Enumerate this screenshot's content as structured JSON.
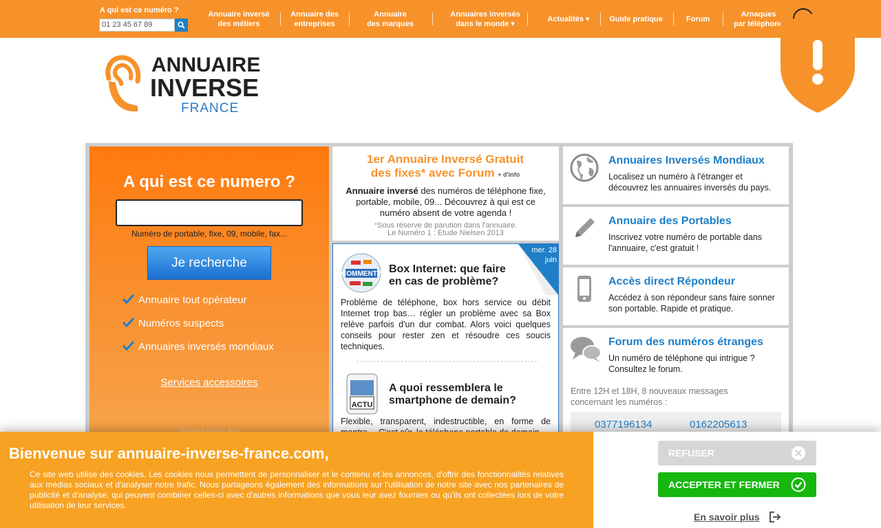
{
  "topbar": {
    "search_label": "A qui est ce numéro ?",
    "search_value": "01 23 45 67 89",
    "nav": [
      {
        "l1": "Annuaire inversé",
        "l2": "des métiers"
      },
      {
        "l1": "Annuaire des",
        "l2": "entreprises"
      },
      {
        "l1": "Annuaire",
        "l2": "des marques"
      },
      {
        "l1": "Annuaires inversés",
        "l2": "dans le monde ▾"
      },
      {
        "l1": "Actualités ▾",
        "l2": ""
      },
      {
        "l1": "Guide pratique",
        "l2": ""
      },
      {
        "l1": "Forum",
        "l2": ""
      },
      {
        "l1": "Arnaques",
        "l2": "par téléphone"
      }
    ]
  },
  "logo": {
    "line1": "ANNUAIRE",
    "line2": "INVERSE",
    "line3": "FRANCE"
  },
  "search_panel": {
    "title": "A qui est ce numero ?",
    "hint": "Numéro de portable, fixe, 09, mobile, fax...",
    "button": "Je recherche",
    "features": [
      "Annuaire tout opérateur",
      "Numéros suspects",
      "Annuaires inversés mondiaux"
    ],
    "services_link": "Services accessoires",
    "follow": "Suivez-nous sur"
  },
  "promo": {
    "title_l1": "1er Annuaire Inversé Gratuit",
    "title_l2": "des fixes* avec Forum",
    "info": "+ d'info",
    "body_bold": "Annuaire inversé",
    "body_rest": " des numéros de téléphone fixe, portable, mobile, 09... Découvrez à qui est ce numéro absent de votre agenda !",
    "note_star": "*",
    "note_l1": "Sous réserve de parution dans l'annuaire.",
    "note_l2": "Le Numéro 1 : Etude Nielsen 2013"
  },
  "news": {
    "date_l1": "mer. 28",
    "date_l2": "juin",
    "items": [
      {
        "title_l1": "Box Internet: que faire",
        "title_l2": "en cas de problème?",
        "text": "Problème de téléphone, box hors service ou débit Internet trop bas… régler un problème avec sa Box relève parfois d'un dur combat. Alors voici quelques conseils pour rester zen et résoudre ces soucis techniques."
      },
      {
        "title_l1": "A quoi ressemblera le",
        "title_l2": "smartphone de demain?",
        "thumb_label": "ACTU",
        "text": "Flexible, transparent, indestructible, en forme de montre… C'est sûr, le téléphone portable de demain"
      }
    ]
  },
  "right_cards": [
    {
      "icon": "globe-icon",
      "title": "Annuaires Inversés Mondiaux",
      "body": "Localisez un numéro à l'étranger et découvrez les annuaires inversés du pays."
    },
    {
      "icon": "pencil-icon",
      "title": "Annuaire des Portables",
      "body": "Inscrivez votre numéro de portable dans l'annuaire, c'est gratuit !"
    },
    {
      "icon": "mobile-phone-icon",
      "title": "Accès direct Répondeur",
      "body": "Accédez à son répondeur sans faire sonner son portable. Rapide et pratique."
    },
    {
      "icon": "chat-bubbles-icon",
      "title": "Forum des numéros étranges",
      "body": "Un numéro de téléphone qui intrigue ? Consultez le forum."
    }
  ],
  "forum": {
    "recent": "Entre 12H et 18H, 8 nouveaux messages concernant les numéros :",
    "numbers": [
      "0377196134",
      "0162205613"
    ]
  },
  "cookie": {
    "title": "Bienvenue sur annuaire-inverse-france.com,",
    "text": "Ce site web utilise des cookies. Les cookies nous permettent de personnaliser et le contenu et les annonces, d'offrir des fonctionnalités relatives aux médias sociaux et d'analyser notre trafic. Nous partageons également des informations sur l'utilisation de notre site avec nos partenaires de publicité et d'analyse, qui peuvent combiner celles-ci avec d'autres informations que vous leur avez fournies ou qu'ils ont collectées lors de votre utilisation de leur services.",
    "refuse": "REFUSER",
    "accept": "ACCEPTER ET FERMER",
    "more": "En savoir plus"
  },
  "colors": {
    "brand_orange": "#f7922a",
    "brand_blue": "#1e7fc8",
    "accept_green": "#16b70e"
  }
}
